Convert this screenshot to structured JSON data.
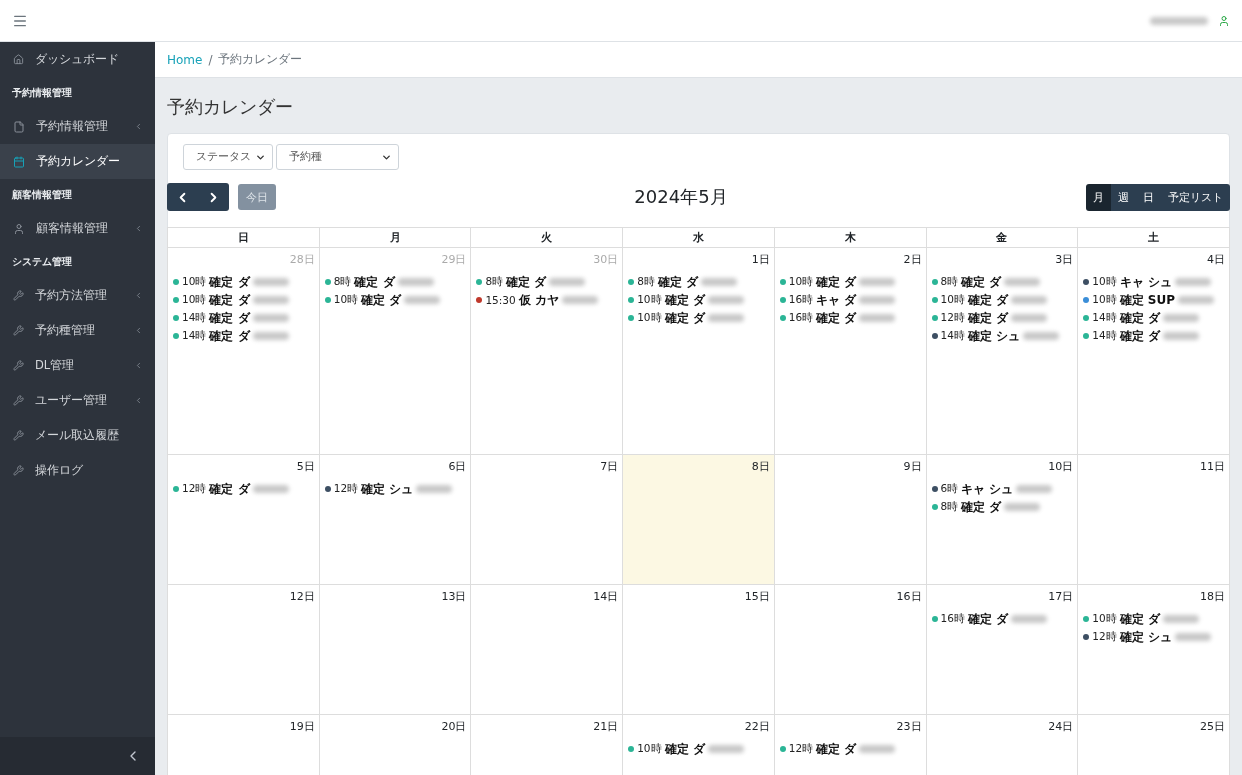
{
  "breadcrumb": {
    "home": "Home",
    "separator": "/",
    "current": "予約カレンダー"
  },
  "sidebar": {
    "items": [
      {
        "kind": "item",
        "label": "ダッシュボード",
        "selected": false,
        "expandable": false
      },
      {
        "kind": "header",
        "label": "予約情報管理"
      },
      {
        "kind": "item",
        "label": "予約情報管理",
        "selected": false,
        "expandable": true
      },
      {
        "kind": "item",
        "label": "予約カレンダー",
        "selected": true,
        "expandable": false
      },
      {
        "kind": "header",
        "label": "顧客情報管理"
      },
      {
        "kind": "item",
        "label": "顧客情報管理",
        "selected": false,
        "expandable": true
      },
      {
        "kind": "header",
        "label": "システム管理"
      },
      {
        "kind": "item",
        "label": "予約方法管理",
        "selected": false,
        "expandable": true
      },
      {
        "kind": "item",
        "label": "予約種管理",
        "selected": false,
        "expandable": true
      },
      {
        "kind": "item",
        "label": "DL管理",
        "selected": false,
        "expandable": true
      },
      {
        "kind": "item",
        "label": "ユーザー管理",
        "selected": false,
        "expandable": true
      },
      {
        "kind": "item",
        "label": "メール取込履歴",
        "selected": false,
        "expandable": false
      },
      {
        "kind": "item",
        "label": "操作ログ",
        "selected": false,
        "expandable": false
      }
    ]
  },
  "page_title": "予約カレンダー",
  "filters": [
    {
      "label": "ステータス"
    },
    {
      "label": "予約種"
    }
  ],
  "calendar": {
    "title": "2024年5月",
    "today_button": "今日",
    "views": [
      {
        "label": "月",
        "selected": true
      },
      {
        "label": "週",
        "selected": false
      },
      {
        "label": "日",
        "selected": false
      },
      {
        "label": "予定リスト",
        "selected": false
      }
    ],
    "weekdays": [
      "日",
      "月",
      "火",
      "水",
      "木",
      "金",
      "土"
    ],
    "weeks": [
      [
        {
          "day": "28日",
          "muted": true,
          "today": false,
          "events": [
            {
              "time": "10時",
              "label": "確定 ダ",
              "color": "#2bb596"
            },
            {
              "time": "10時",
              "label": "確定 ダ",
              "color": "#2bb596"
            },
            {
              "time": "14時",
              "label": "確定 ダ",
              "color": "#2bb596"
            },
            {
              "time": "14時",
              "label": "確定 ダ",
              "color": "#2bb596"
            }
          ]
        },
        {
          "day": "29日",
          "muted": true,
          "today": false,
          "events": [
            {
              "time": "8時",
              "label": "確定 ダ",
              "color": "#2bb596"
            },
            {
              "time": "10時",
              "label": "確定 ダ",
              "color": "#2bb596"
            }
          ]
        },
        {
          "day": "30日",
          "muted": true,
          "today": false,
          "events": [
            {
              "time": "8時",
              "label": "確定 ダ",
              "color": "#2bb596"
            },
            {
              "time": "15:30",
              "label": "仮 カヤ",
              "color": "#c0392b"
            }
          ]
        },
        {
          "day": "1日",
          "muted": false,
          "today": false,
          "events": [
            {
              "time": "8時",
              "label": "確定 ダ",
              "color": "#2bb596"
            },
            {
              "time": "10時",
              "label": "確定 ダ",
              "color": "#2bb596"
            },
            {
              "time": "10時",
              "label": "確定 ダ",
              "color": "#2bb596"
            }
          ]
        },
        {
          "day": "2日",
          "muted": false,
          "today": false,
          "events": [
            {
              "time": "10時",
              "label": "確定 ダ",
              "color": "#2bb596"
            },
            {
              "time": "16時",
              "label": "キャ ダ",
              "color": "#2bb596"
            },
            {
              "time": "16時",
              "label": "確定 ダ",
              "color": "#2bb596"
            }
          ]
        },
        {
          "day": "3日",
          "muted": false,
          "today": false,
          "events": [
            {
              "time": "8時",
              "label": "確定 ダ",
              "color": "#2bb596"
            },
            {
              "time": "10時",
              "label": "確定 ダ",
              "color": "#2bb596"
            },
            {
              "time": "12時",
              "label": "確定 ダ",
              "color": "#2bb596"
            },
            {
              "time": "14時",
              "label": "確定 シュ",
              "color": "#3d4f63"
            }
          ]
        },
        {
          "day": "4日",
          "muted": false,
          "today": false,
          "events": [
            {
              "time": "10時",
              "label": "キャ シュ",
              "color": "#3d4f63"
            },
            {
              "time": "10時",
              "label": "確定 SUP",
              "color": "#3b8ed8"
            },
            {
              "time": "14時",
              "label": "確定 ダ",
              "color": "#2bb596"
            },
            {
              "time": "14時",
              "label": "確定 ダ",
              "color": "#2bb596"
            }
          ]
        }
      ],
      [
        {
          "day": "5日",
          "muted": false,
          "today": false,
          "events": [
            {
              "time": "12時",
              "label": "確定 ダ",
              "color": "#2bb596"
            }
          ]
        },
        {
          "day": "6日",
          "muted": false,
          "today": false,
          "events": [
            {
              "time": "12時",
              "label": "確定 シュ",
              "color": "#3d4f63"
            }
          ]
        },
        {
          "day": "7日",
          "muted": false,
          "today": false
        },
        {
          "day": "8日",
          "muted": false,
          "today": true
        },
        {
          "day": "9日",
          "muted": false,
          "today": false
        },
        {
          "day": "10日",
          "muted": false,
          "today": false,
          "events": [
            {
              "time": "6時",
              "label": "キャ シュ",
              "color": "#3d4f63"
            },
            {
              "time": "8時",
              "label": "確定 ダ",
              "color": "#2bb596"
            }
          ]
        },
        {
          "day": "11日",
          "muted": false,
          "today": false
        }
      ],
      [
        {
          "day": "12日",
          "muted": false,
          "today": false
        },
        {
          "day": "13日",
          "muted": false,
          "today": false
        },
        {
          "day": "14日",
          "muted": false,
          "today": false
        },
        {
          "day": "15日",
          "muted": false,
          "today": false
        },
        {
          "day": "16日",
          "muted": false,
          "today": false
        },
        {
          "day": "17日",
          "muted": false,
          "today": false,
          "events": [
            {
              "time": "16時",
              "label": "確定 ダ",
              "color": "#2bb596"
            }
          ]
        },
        {
          "day": "18日",
          "muted": false,
          "today": false,
          "events": [
            {
              "time": "10時",
              "label": "確定 ダ",
              "color": "#2bb596"
            },
            {
              "time": "12時",
              "label": "確定 シュ",
              "color": "#3d4f63"
            }
          ]
        }
      ],
      [
        {
          "day": "19日",
          "muted": false,
          "today": false
        },
        {
          "day": "20日",
          "muted": false,
          "today": false
        },
        {
          "day": "21日",
          "muted": false,
          "today": false
        },
        {
          "day": "22日",
          "muted": false,
          "today": false,
          "events": [
            {
              "time": "10時",
              "label": "確定 ダ",
              "color": "#2bb596"
            }
          ]
        },
        {
          "day": "23日",
          "muted": false,
          "today": false,
          "events": [
            {
              "time": "12時",
              "label": "確定 ダ",
              "color": "#2bb596"
            }
          ]
        },
        {
          "day": "24日",
          "muted": false,
          "today": false
        },
        {
          "day": "25日",
          "muted": false,
          "today": false
        }
      ]
    ]
  }
}
